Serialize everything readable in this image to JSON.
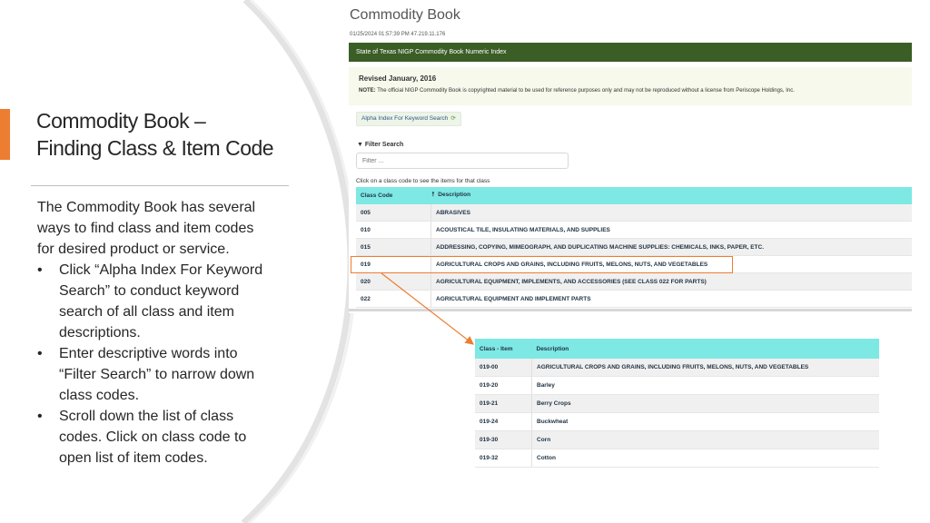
{
  "slide": {
    "title_line1": "Commodity Book –",
    "title_line2": "Finding Class & Item Code",
    "intro": "The Commodity Book has several ways to find class and item codes for desired product or service.",
    "bullets": [
      "Click “Alpha Index For Keyword Search” to conduct keyword search of all class and item descriptions.",
      "Enter descriptive words into “Filter Search” to narrow down class codes.",
      "Scroll down the list of class codes.  Click on class code to open list of item codes."
    ],
    "bullet_glyph": "•",
    "accent_color": "#ed7d31"
  },
  "app": {
    "title": "Commodity Book",
    "meta": "01/25/2024 01:57:39 PM    47.219.11.176",
    "header_bar": "State of Texas NIGP Commodity Book Numeric Index",
    "notice_heading": "Revised January, 2016",
    "notice_label": "NOTE:",
    "notice_text": " The official NIGP Commodity Book is copyrighted material to be used for reference purposes only and may not be reproduced without a license from Periscope Holdings, Inc.",
    "alpha_button": "Alpha Index For Keyword Search",
    "alpha_icon": "refresh-icon",
    "filter_label": "Filter Search",
    "filter_icon": "funnel-icon",
    "filter_placeholder": "Filter ...",
    "click_hint": "Click on a class code to see the items for that class",
    "table_headers": {
      "code": "Class Code",
      "desc": "Description"
    },
    "sort_icon": "sort-up-arrow-icon",
    "rows": [
      {
        "code": "005",
        "desc": "ABRASIVES"
      },
      {
        "code": "010",
        "desc": "ACOUSTICAL TILE, INSULATING MATERIALS, AND SUPPLIES"
      },
      {
        "code": "015",
        "desc": "ADDRESSING, COPYING, MIMEOGRAPH, AND DUPLICATING MACHINE SUPPLIES: CHEMICALS, INKS, PAPER, ETC."
      },
      {
        "code": "019",
        "desc": "AGRICULTURAL CROPS AND GRAINS, INCLUDING FRUITS, MELONS, NUTS, AND VEGETABLES"
      },
      {
        "code": "020",
        "desc": "AGRICULTURAL EQUIPMENT, IMPLEMENTS, AND ACCESSORIES (SEE CLASS 022 FOR PARTS)"
      },
      {
        "code": "022",
        "desc": "AGRICULTURAL EQUIPMENT AND IMPLEMENT PARTS"
      }
    ]
  },
  "items": {
    "headers": {
      "code": "Class - Item",
      "desc": "Description"
    },
    "rows": [
      {
        "code": "019-00",
        "desc": "AGRICULTURAL CROPS AND GRAINS, INCLUDING FRUITS, MELONS, NUTS, AND VEGETABLES"
      },
      {
        "code": "019-20",
        "desc": "Barley"
      },
      {
        "code": "019-21",
        "desc": "Berry Crops"
      },
      {
        "code": "019-24",
        "desc": "Buckwheat"
      },
      {
        "code": "019-30",
        "desc": "Corn"
      },
      {
        "code": "019-32",
        "desc": "Cotton"
      }
    ]
  }
}
